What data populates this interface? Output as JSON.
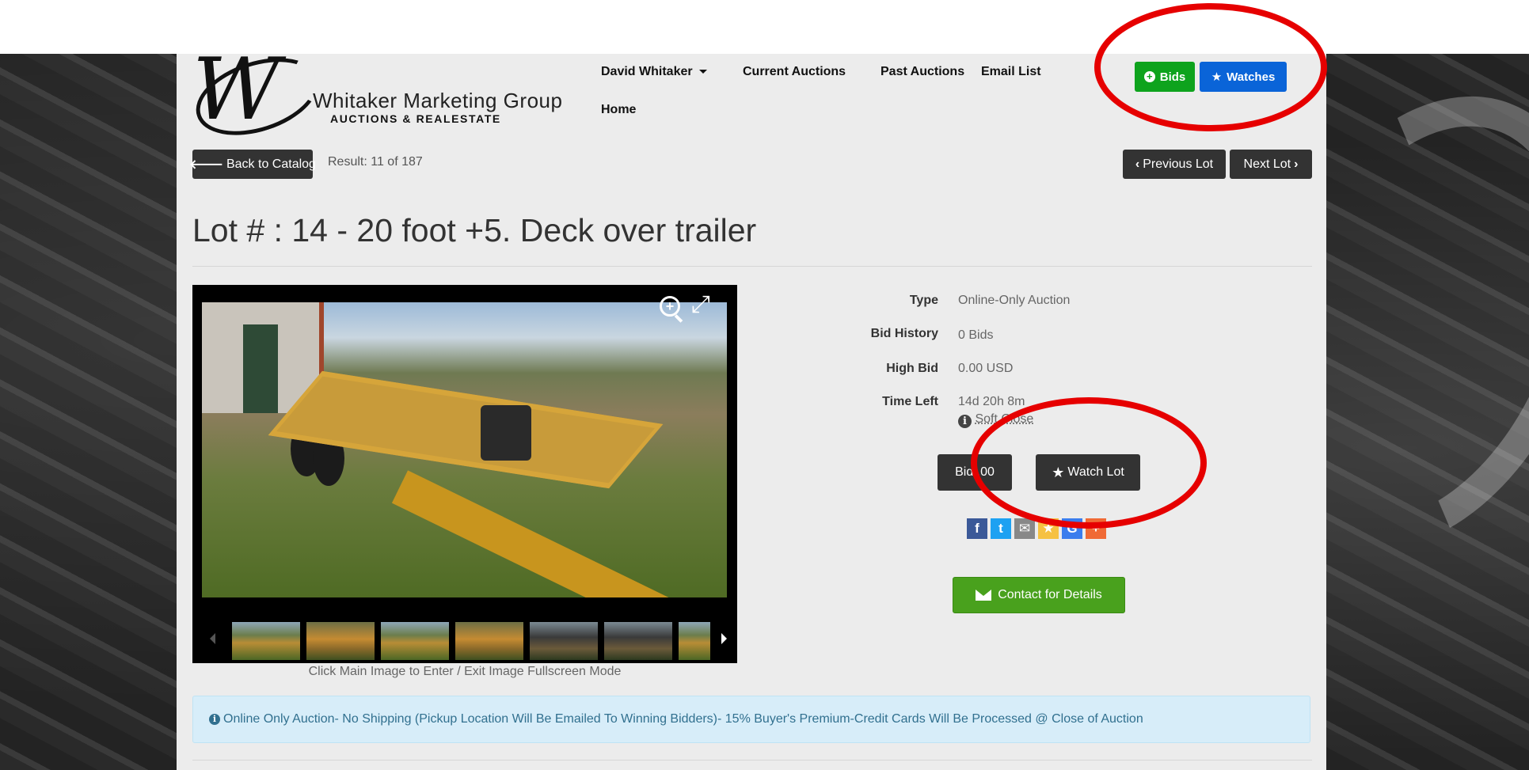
{
  "header": {
    "logo": {
      "name": "Whitaker Marketing Group",
      "subtitle": "AUCTIONS & REALESTATE"
    },
    "nav": [
      {
        "label": "David Whitaker"
      },
      {
        "label": "Current Auctions"
      },
      {
        "label": "Past Auctions"
      },
      {
        "label": "Email List"
      },
      {
        "label": "Home"
      }
    ],
    "bids_label": "Bids",
    "watches_label": "Watches"
  },
  "catalog": {
    "back_label": "Back to Catalog",
    "result": "Result: 11 of 187",
    "prev_label": "Previous Lot",
    "next_label": "Next Lot"
  },
  "lot": {
    "title": "Lot # : 14 - 20 foot +5. Deck over trailer",
    "image_caption": "Click Main Image to Enter / Exit Image Fullscreen Mode",
    "thumbnail_count": 7,
    "details": {
      "type_label": "Type",
      "type_value": "Online-Only Auction",
      "history_label": "Bid History",
      "history_value": "0 Bids",
      "high_label": "High Bid",
      "high_value": "0.00 USD",
      "time_label": "Time Left",
      "time_value": "14d 20h 8m",
      "soft_close": "Soft Close"
    },
    "bid_button": "Bid .00",
    "watch_button": "Watch Lot",
    "contact_button": "Contact for Details"
  },
  "share": [
    {
      "icon": "facebook-icon",
      "glyph": "f",
      "color": "#3b5998"
    },
    {
      "icon": "twitter-icon",
      "glyph": "t",
      "color": "#1da1f2"
    },
    {
      "icon": "email-icon",
      "glyph": "✉",
      "color": "#888888"
    },
    {
      "icon": "favorite-icon",
      "glyph": "★",
      "color": "#f6c142"
    },
    {
      "icon": "google-icon",
      "glyph": "G",
      "color": "#3b7ded"
    },
    {
      "icon": "more-icon",
      "glyph": "+",
      "color": "#f06a35"
    }
  ],
  "notice": "Online Only Auction- No Shipping (Pickup Location Will Be Emailed To Winning Bidders)- 15% Buyer's Premium-Credit Cards Will Be Processed @ Close of Auction",
  "colors": {
    "bids": "#0ea31d",
    "watches": "#0a64d8",
    "contact": "#49a11d",
    "annotation": "#e60000"
  }
}
